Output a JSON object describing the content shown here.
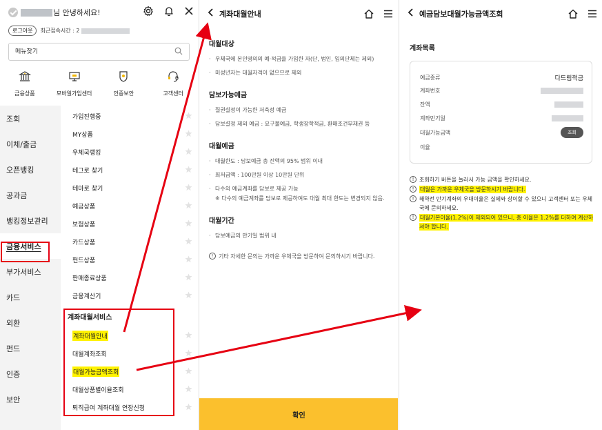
{
  "panel1": {
    "greeting": "님 안녕하세요!",
    "logout": "로그아웃",
    "last_login_label": "최근접속시간 : 2",
    "search_placeholder": "메뉴찾기",
    "quick_menu": [
      "금융상품",
      "모바일가입센터",
      "인증보안",
      "고객센터"
    ],
    "categories": [
      "조회",
      "이체/출금",
      "오픈뱅킹",
      "공과금",
      "뱅킹정보관리",
      "금융서비스",
      "부가서비스",
      "카드",
      "외환",
      "펀드",
      "인증",
      "보안"
    ],
    "sub_items": [
      "가입진행중",
      "MY상품",
      "우체국랭킹",
      "테그로 찾기",
      "테마로 찾기",
      "예금상품",
      "보험상품",
      "카드상품",
      "펀드상품",
      "판매종료상품",
      "금융계산기"
    ],
    "sub_header": "계좌대월서비스",
    "service_items": [
      "계좌대월안내",
      "대월계좌조회",
      "대월가능금액조회",
      "대월상품별이율조회",
      "퇴직급여 계좌대월 연장신청"
    ]
  },
  "panel2": {
    "title": "계좌대월안내",
    "sections": [
      {
        "title": "대월대상",
        "bullets": [
          "우체국에 본인명의의 예·적금을 가입한 자(단, 법인, 임의단체는 제외)",
          "미성년자는 대월자격이 없으므로 제외"
        ]
      },
      {
        "title": "담보가능예금",
        "bullets": [
          "질권설정이 가능한 저축성 예금",
          "담보설정 제외 예금 : 요구불예금, 학생장학적금, 환매조건부채권 등"
        ]
      },
      {
        "title": "대월예금",
        "bullets": [
          "대월한도 : 담보예금 총 잔액의 95% 범위 이내",
          "최저금액 : 100만원 이상 10만원 단위",
          "다수의 예금계좌를 담보로 제공 가능"
        ],
        "note": "※ 다수의 예금계좌를 담보로 제공하여도 대월 최대 한도는 변경되지 않음."
      },
      {
        "title": "대월기간",
        "bullets": [
          "담보예금의 만기일 범위 내"
        ]
      }
    ],
    "info": "기타 자세한 문의는 가까운 우체국을 방문하여 문의하시기 바랍니다.",
    "confirm": "확인"
  },
  "panel3": {
    "title": "예금담보대월가능금액조회",
    "account_list_title": "계좌목록",
    "fields": {
      "deposit_type_label": "예금종류",
      "deposit_type_value": "다드림적금",
      "account_no_label": "계좌번호",
      "balance_label": "잔액",
      "maturity_label": "계좌만기일",
      "available_label": "대월가능금액",
      "interest_label": "이율"
    },
    "query_button": "조회",
    "notes": [
      {
        "text": "조회하기 버튼을 눌러서 가능 금액을 확인하세요.",
        "highlight": ""
      },
      {
        "text": "",
        "highlight": "대월은 가까운 우체국을 방문하시기 바랍니다."
      },
      {
        "text": "해약전 만기계좌의 우대이율은 실제와 상이할 수 있으니 고객센터 또는 우체국에 문의하세요.",
        "highlight": ""
      },
      {
        "text": "",
        "highlight": "대월기본이율(1.2%)이 제외되어 있으니, 총 이율은 1.2%를 더하여 계산하셔야 합니다."
      }
    ]
  },
  "colors": {
    "accent": "#fbc02d",
    "highlight": "#fff200",
    "annotation": "#e60012"
  }
}
